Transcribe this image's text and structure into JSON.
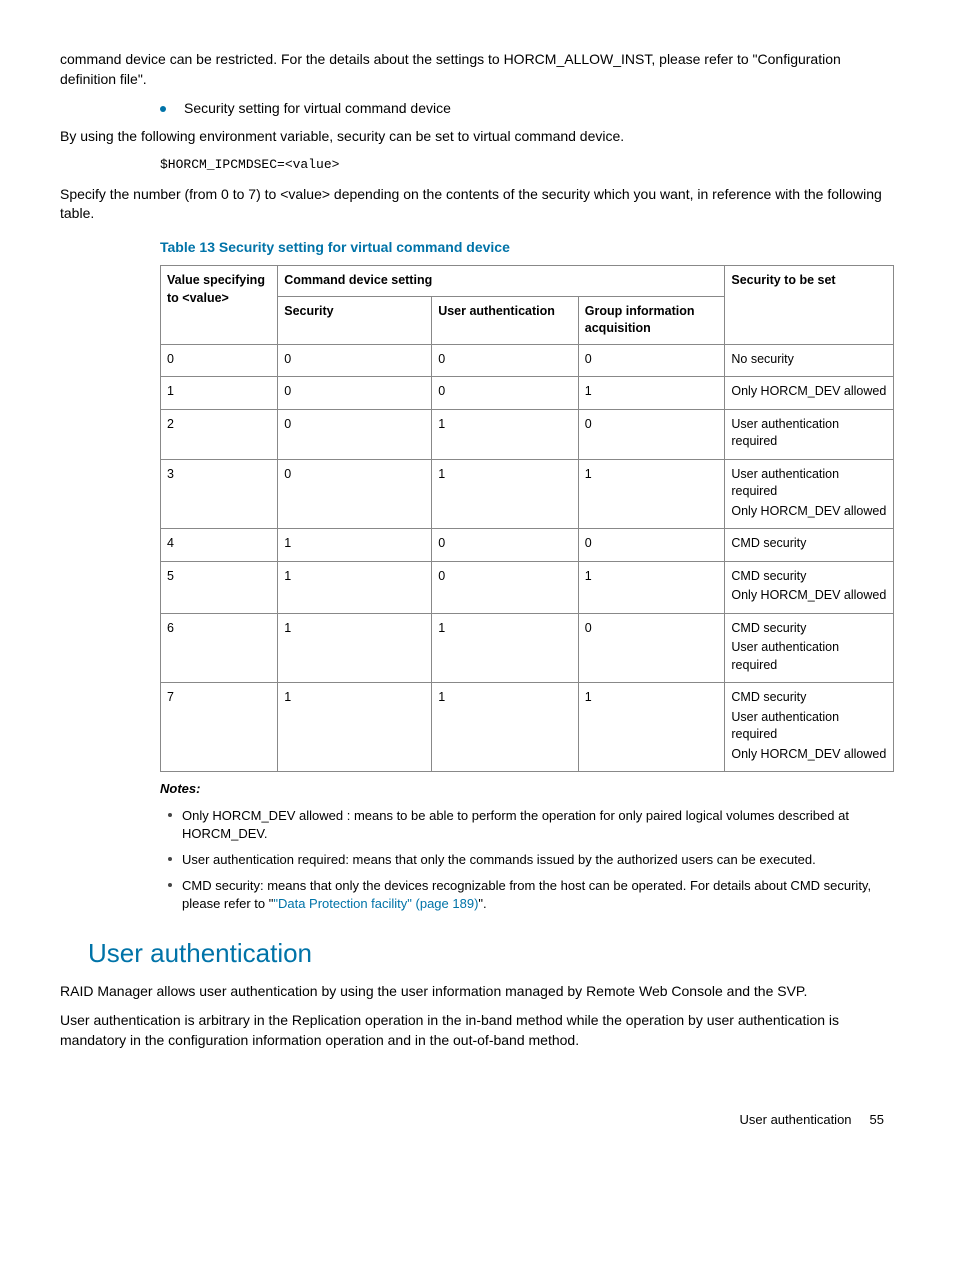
{
  "intro": {
    "p1": "command device can be restricted. For the details about the settings to HORCM_ALLOW_INST, please refer to \"Configuration definition file\".",
    "bullet1": "Security setting for virtual command device",
    "p2": "By using the following environment variable, security can be set to virtual command device.",
    "code": "$HORCM_IPCMDSEC=<value>",
    "p3": "Specify the number (from 0 to 7) to <value> depending on the contents of the security which you want, in reference with the following table."
  },
  "table": {
    "title": "Table 13 Security setting for virtual command device",
    "headers": {
      "c1": "Value specifying to <value>",
      "c2_group": "Command device setting",
      "c2a": "Security",
      "c2b": "User authentication",
      "c2c": "Group information acquisition",
      "c3": "Security to be set"
    },
    "rows": [
      {
        "v": "0",
        "s": "0",
        "u": "0",
        "g": "0",
        "r": [
          "No security"
        ]
      },
      {
        "v": "1",
        "s": "0",
        "u": "0",
        "g": "1",
        "r": [
          "Only HORCM_DEV allowed"
        ]
      },
      {
        "v": "2",
        "s": "0",
        "u": "1",
        "g": "0",
        "r": [
          "User authentication required"
        ]
      },
      {
        "v": "3",
        "s": "0",
        "u": "1",
        "g": "1",
        "r": [
          "User authentication required",
          "Only HORCM_DEV allowed"
        ]
      },
      {
        "v": "4",
        "s": "1",
        "u": "0",
        "g": "0",
        "r": [
          "CMD security"
        ]
      },
      {
        "v": "5",
        "s": "1",
        "u": "0",
        "g": "1",
        "r": [
          "CMD security",
          "Only HORCM_DEV allowed"
        ]
      },
      {
        "v": "6",
        "s": "1",
        "u": "1",
        "g": "0",
        "r": [
          "CMD security",
          "User authentication required"
        ]
      },
      {
        "v": "7",
        "s": "1",
        "u": "1",
        "g": "1",
        "r": [
          "CMD security",
          "User authentication required",
          "Only HORCM_DEV allowed"
        ]
      }
    ]
  },
  "notes": {
    "label": "Notes:",
    "items": [
      {
        "text_a": "Only HORCM_DEV allowed : means to be able to perform the operation for only paired logical volumes described at HORCM_DEV.",
        "link": "",
        "text_b": ""
      },
      {
        "text_a": "User authentication required: means that only the commands issued by the authorized users can be executed.",
        "link": "",
        "text_b": ""
      },
      {
        "text_a": "CMD security: means that only the devices recognizable from the host can be operated. For details about CMD security, please refer to \"",
        "link": "\"Data Protection facility\" (page 189)",
        "text_b": "\"."
      }
    ]
  },
  "section": {
    "heading": "User authentication",
    "p1": "RAID Manager allows user authentication by using the user information managed by Remote Web Console and the SVP.",
    "p2": "User authentication is arbitrary in the Replication operation in the in-band method while the operation by user authentication is mandatory in the configuration information operation and in the out-of-band method."
  },
  "footer": {
    "label": "User authentication",
    "page": "55"
  }
}
